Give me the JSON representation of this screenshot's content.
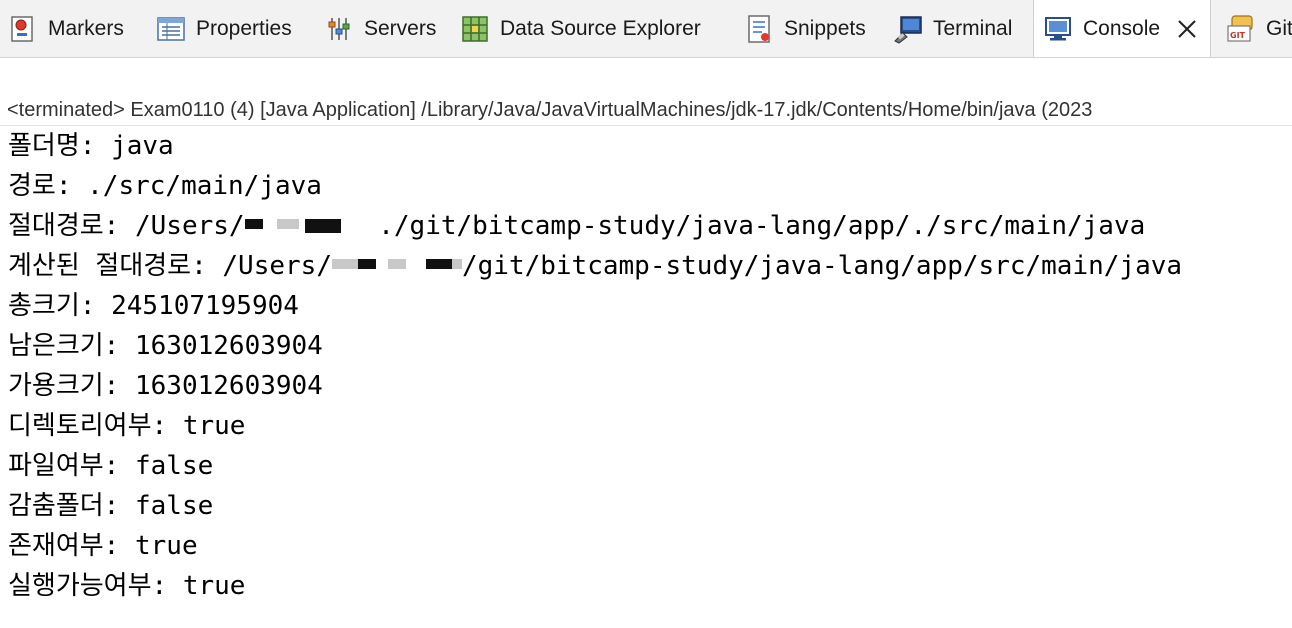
{
  "tabs": [
    {
      "label": "Markers",
      "icon": "markers-icon",
      "active": false
    },
    {
      "label": "Properties",
      "icon": "properties-icon",
      "active": false
    },
    {
      "label": "Servers",
      "icon": "servers-icon",
      "active": false
    },
    {
      "label": "Data Source Explorer",
      "icon": "data-source-explorer-icon",
      "active": false
    },
    {
      "label": "Snippets",
      "icon": "snippets-icon",
      "active": false
    },
    {
      "label": "Terminal",
      "icon": "terminal-icon",
      "active": false
    },
    {
      "label": "Console",
      "icon": "console-icon",
      "active": true
    },
    {
      "label": "Git",
      "icon": "git-icon",
      "active": false
    }
  ],
  "console": {
    "status": "<terminated> Exam0110 (4) [Java Application] /Library/Java/JavaVirtualMachines/jdk-17.jdk/Contents/Home/bin/java  (2023",
    "lines": [
      {
        "label": "폴더명:",
        "value": " java"
      },
      {
        "label": "경로:",
        "value": " ./src/main/java"
      },
      {
        "label": "절대경로:",
        "value_prefix": " /Users/",
        "value_suffix": " ./git/bitcamp-study/java-lang/app/./src/main/java"
      },
      {
        "label": "계산된 절대경로:",
        "value_prefix": " /Users/",
        "value_suffix": "/git/bitcamp-study/java-lang/app/src/main/java"
      },
      {
        "label": "총크기:",
        "value": " 245107195904"
      },
      {
        "label": "남은크기:",
        "value": " 163012603904"
      },
      {
        "label": "가용크기:",
        "value": " 163012603904"
      },
      {
        "label": "디렉토리여부:",
        "value": " true"
      },
      {
        "label": "파일여부:",
        "value": " false"
      },
      {
        "label": "감춤폴더:",
        "value": " false"
      },
      {
        "label": "존재여부:",
        "value": " true"
      },
      {
        "label": "실행가능여부:",
        "value": " true"
      }
    ]
  },
  "colors": {
    "redaction_dark": "#111111",
    "redaction_light": "#c8c8c8",
    "active_tab": "#ffffff",
    "tabbar_bg": "#f2f2f2"
  }
}
